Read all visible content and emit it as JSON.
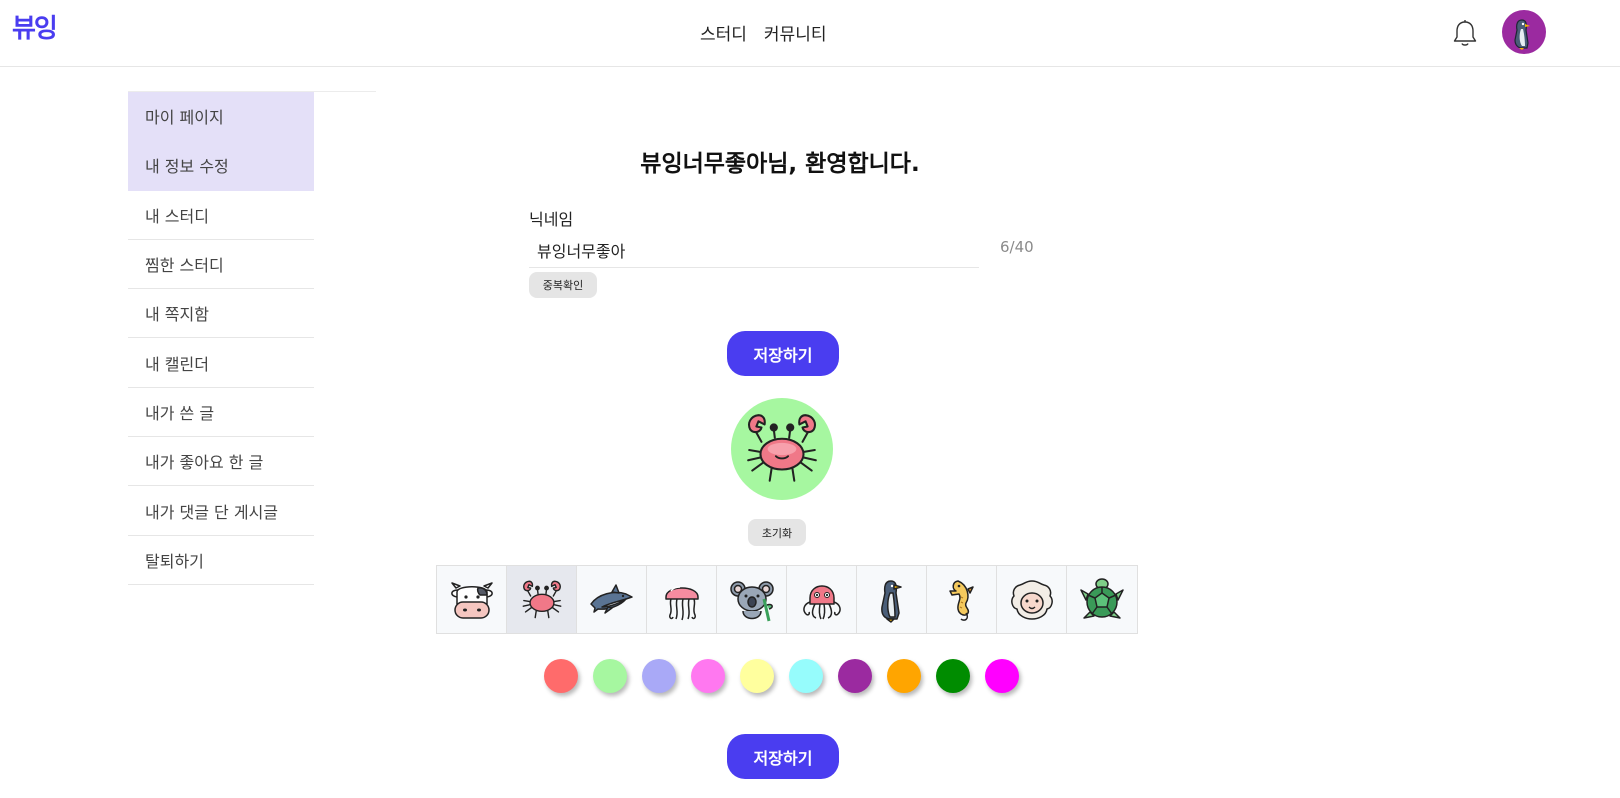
{
  "header": {
    "logo": "뷰잉",
    "nav": [
      "스터디",
      "커뮤니티"
    ]
  },
  "sidebar": {
    "items": [
      {
        "label": "마이 페이지",
        "active": true
      },
      {
        "label": "내 정보 수정",
        "active": true
      },
      {
        "label": "내 스터디",
        "active": false
      },
      {
        "label": "찜한 스터디",
        "active": false
      },
      {
        "label": "내 쪽지함",
        "active": false
      },
      {
        "label": "내 캘린더",
        "active": false
      },
      {
        "label": "내가 쓴 글",
        "active": false
      },
      {
        "label": "내가 좋아요 한 글",
        "active": false
      },
      {
        "label": "내가 댓글 단 게시글",
        "active": false
      },
      {
        "label": "탈퇴하기",
        "active": false
      }
    ]
  },
  "main": {
    "welcome": "뷰잉너무좋아님, 환영합니다.",
    "nickname_label": "닉네임",
    "nickname_value": "뷰잉너무좋아",
    "nickname_count": "6/40",
    "duplicate_check_label": "중복확인",
    "save_label": "저장하기",
    "reset_label": "초기화",
    "preview_bg": "#a6f7a0",
    "selected_animal": "crab-icon"
  },
  "animals": [
    "cow-icon",
    "crab-icon",
    "dolphin-icon",
    "jellyfish-icon",
    "koala-icon",
    "octopus-icon",
    "penguin-icon",
    "seahorse-icon",
    "sheep-icon",
    "turtle-icon"
  ],
  "colors": [
    "#ff6b6b",
    "#a6f7a0",
    "#a9a9f7",
    "#ff78f0",
    "#ffff9e",
    "#96fcfc",
    "#9b2aa0",
    "#ffa500",
    "#008c00",
    "#ff00ff"
  ]
}
